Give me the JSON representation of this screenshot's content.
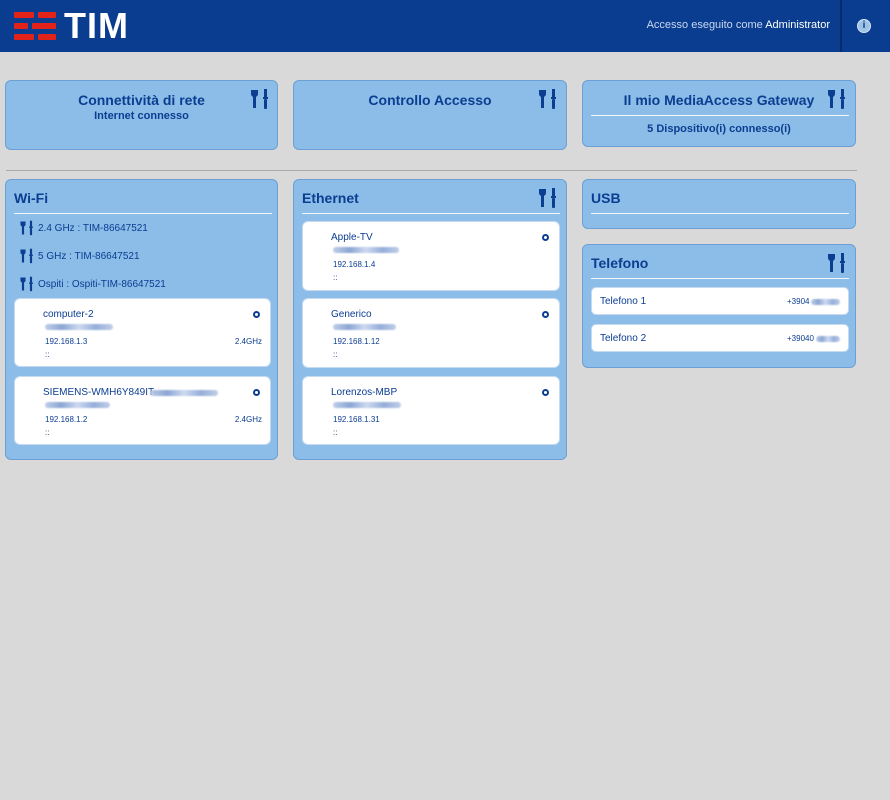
{
  "brand": {
    "logo_text": "TIM",
    "accent_color": "#e2231a",
    "header_color": "#0a3d8f"
  },
  "header": {
    "login_prefix": "Accesso eseguito come",
    "login_user": "Administrator",
    "info_icon": "info-icon"
  },
  "cards": {
    "network": {
      "title": "Connettività di rete",
      "subtitle": "Internet connesso"
    },
    "access": {
      "title": "Controllo Accesso"
    },
    "gateway": {
      "title": "Il mio MediaAccess Gateway",
      "subtitle": "5 Dispositivo(i) connesso(i)"
    },
    "wifi": {
      "title": "Wi-Fi",
      "networks": [
        {
          "label": "2.4 GHz : TIM-86647521"
        },
        {
          "label": "5 GHz  : TIM-86647521"
        },
        {
          "label": "Ospiti  : Ospiti-TIM-86647521"
        }
      ],
      "devices": [
        {
          "name": "computer-2",
          "ip": "192.168.1.3",
          "band": "2.4GHz",
          "ipv6": "::"
        },
        {
          "name": "SIEMENS-WMH6Y849IT-",
          "ip": "192.168.1.2",
          "band": "2.4GHz",
          "ipv6": "::"
        }
      ]
    },
    "ethernet": {
      "title": "Ethernet",
      "devices": [
        {
          "name": "Apple-TV",
          "ip": "192.168.1.4",
          "ipv6": "::"
        },
        {
          "name": "Generico",
          "ip": "192.168.1.12",
          "ipv6": "::"
        },
        {
          "name": "Lorenzos-MBP",
          "ip": "192.168.1.31",
          "ipv6": "::"
        }
      ]
    },
    "usb": {
      "title": "USB"
    },
    "telefono": {
      "title": "Telefono",
      "lines": [
        {
          "name": "Telefono 1",
          "number_prefix": "+3904"
        },
        {
          "name": "Telefono 2",
          "number_prefix": "+39040"
        }
      ]
    }
  },
  "icons": {
    "tool": "wrench-screwdriver-icon",
    "device_status": "status-dot-icon"
  }
}
